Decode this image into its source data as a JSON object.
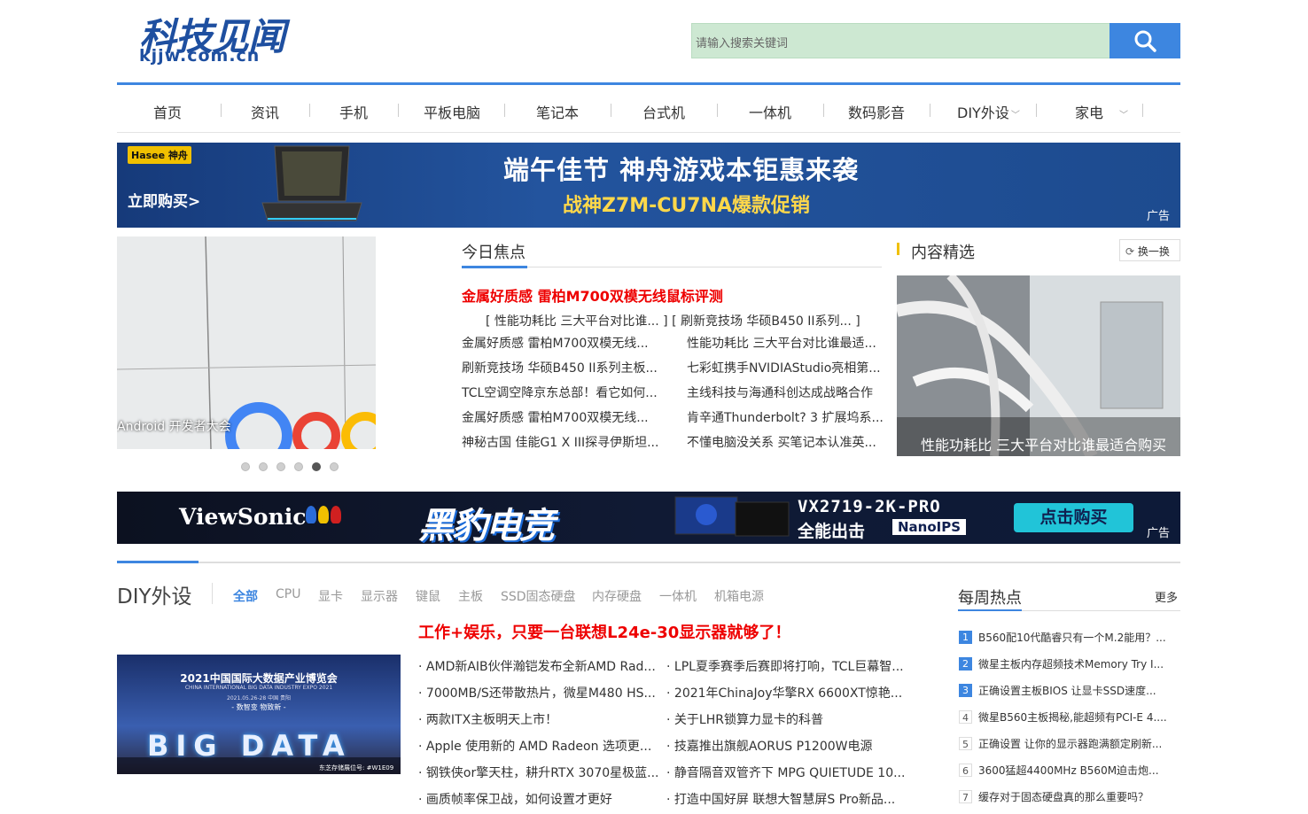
{
  "logo": {
    "cn": "科技见闻",
    "en": "kjjw.com.cn"
  },
  "search": {
    "placeholder": "请输入搜索关键词"
  },
  "nav": {
    "items": [
      "首页",
      "资讯",
      "手机",
      "平板电脑",
      "笔记本",
      "台式机",
      "一体机",
      "数码影音",
      "DIY外设",
      "家电"
    ]
  },
  "banner1": {
    "brand": "Hasee 神舟",
    "cta": "立即购买>",
    "headline": "端午佳节 神舟游戏本钜惠来袭",
    "sub": "战神Z7M-CU7NA爆款促销",
    "ad": "广告"
  },
  "slider": {
    "caption": "Android 开发者大会",
    "dots": 6,
    "active": 4
  },
  "focus": {
    "title": "今日焦点",
    "headline": "金属好质感 雷柏M700双模无线鼠标评测",
    "sub": "[ 性能功耗比 三大平台对比谁... ] [ 刷新竞技场 华硕B450 II系列... ]",
    "left": [
      "金属好质感 雷柏M700双模无线...",
      "刷新竞技场 华硕B450 II系列主板...",
      "TCL空调空降京东总部！看它如何...",
      "金属好质感 雷柏M700双模无线...",
      "神秘古国 佳能G1 X III探寻伊斯坦..."
    ],
    "right": [
      "性能功耗比 三大平台对比谁最适...",
      "七彩虹携手NVIDIAStudio亮相第...",
      "主线科技与海通科创达成战略合作",
      "肯辛通Thunderbolt? 3 扩展坞系...",
      "不懂电脑没关系 买笔记本认准英..."
    ]
  },
  "picks": {
    "title": "内容精选",
    "refresh": "换一换",
    "caption": "性能功耗比 三大平台对比谁最适合购买"
  },
  "banner2": {
    "brand": "ViewSonic",
    "headline": "黑豹电竞",
    "model": "VX2719-2K-PRO",
    "slogan": "全能出击",
    "tech": "NanoIPS",
    "cta": "点击购买",
    "ad": "广告"
  },
  "diy": {
    "title": "DIY外设",
    "cats": [
      "全部",
      "CPU",
      "显卡",
      "显示器",
      "键鼠",
      "主板",
      "SSD固态硬盘",
      "内存硬盘",
      "一体机",
      "机箱电源"
    ],
    "headline": "工作+娱乐，只要一台联想L24e-30显示器就够了！",
    "expo": {
      "line1": "2021中国国际大数据产业博览会",
      "line2": "CHINA INTERNATIONAL BIG DATA INDUSTRY EXPO 2021",
      "line3": "2021.05.26-28 中国 贵阳",
      "line4": "- 数智变 物致新 -",
      "big": "BIG DATA",
      "booth": "东芝存储展位号: #W1E09"
    },
    "left": [
      "AMD新AIB伙伴瀚铠发布全新AMD Rad...",
      "7000MB/S还带散热片，微星M480 HS...",
      "两款ITX主板明天上市！",
      "Apple 使用新的 AMD Radeon 选项更...",
      "钢铁侠or擎天柱，耕升RTX 3070星极蓝...",
      "画质帧率保卫战，如何设置才更好"
    ],
    "right": [
      "LPL夏季赛季后赛即将打响，TCL巨幕智...",
      "2021年ChinaJoy华擎RX 6600XT惊艳...",
      "关于LHR锁算力显卡的科普",
      "技嘉推出旗舰AORUS P1200W电源",
      "静音隔音双管齐下 MPG QUIETUDE 10...",
      "打造中国好屏 联想大智慧屏S Pro新品..."
    ]
  },
  "weekly": {
    "title": "每周热点",
    "more": "更多",
    "items": [
      {
        "n": "1",
        "t": "B560配10代酷睿只有一个M.2能用？..."
      },
      {
        "n": "2",
        "t": "微星主板内存超频技术Memory Try I..."
      },
      {
        "n": "3",
        "t": "正确设置主板BIOS 让显卡SSD速度..."
      },
      {
        "n": "4",
        "t": "微星B560主板揭秘,能超频有PCI-E 4...."
      },
      {
        "n": "5",
        "t": "正确设置 让你的显示器跑满额定刷新..."
      },
      {
        "n": "6",
        "t": "3600猛超4400MHz B560M迫击炮..."
      },
      {
        "n": "7",
        "t": "缓存对于固态硬盘真的那么重要吗？"
      }
    ]
  }
}
